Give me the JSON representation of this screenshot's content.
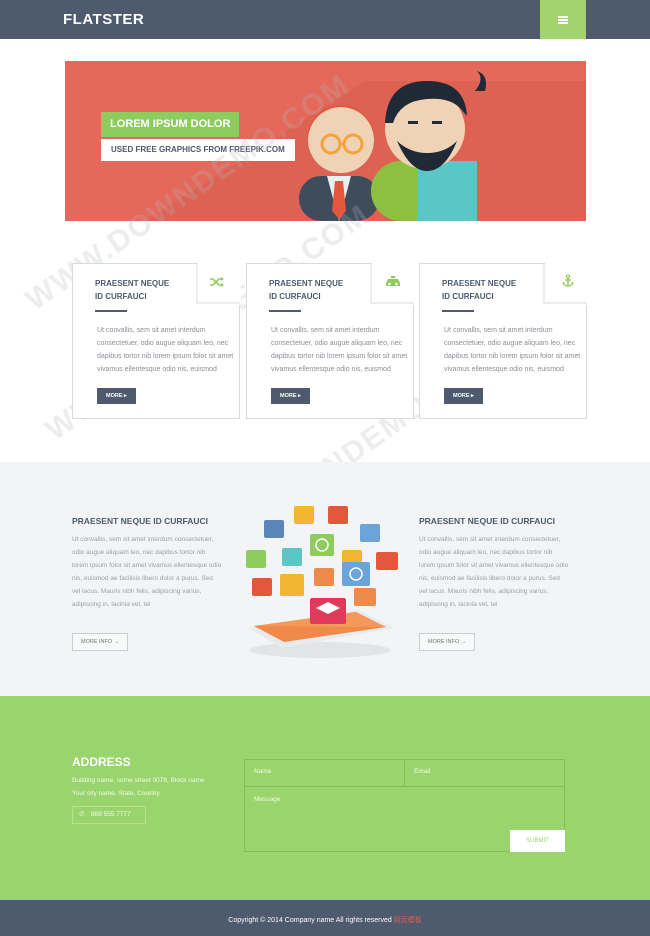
{
  "header": {
    "brand": "FLATSTER",
    "menu_icon": "hamburger-icon"
  },
  "hero": {
    "title": "LOREM IPSUM DOLOR",
    "subtitle": "USED FREE GRAPHICS FROM FREEPIK.COM"
  },
  "cards": [
    {
      "title_line1": "PRAESENT NEQUE",
      "title_line2": "ID CURFAUCI",
      "text": "Ut convallis, sem sit amet interdum consectetuer, odio augue aliquam leo, nec dapibus tortor nib lorem ipsum folor sit amet vivamus ellentesque odio nis, euismod",
      "button": "MORE",
      "icon": "shuffle-icon"
    },
    {
      "title_line1": "PRAESENT NEQUE",
      "title_line2": "ID CURFAUCI",
      "text": "Ut convallis, sem sit amet interdum consectetuer, odio augue aliquam leo, nec dapibus tortor nib lorem ipsum folor sit amet vivamus ellentesque odio nis, euismod",
      "button": "MORE",
      "icon": "taxi-icon"
    },
    {
      "title_line1": "PRAESENT NEQUE",
      "title_line2": "ID CURFAUCI",
      "text": "Ut convallis, sem sit amet interdum consectetuer, odio augue aliquam leo, nec dapibus tortor nib lorem ipsum folor sit amet vivamus ellentesque odio nis, euismod",
      "button": "MORE",
      "icon": "anchor-icon"
    }
  ],
  "info": {
    "left": {
      "title": "PRAESENT NEQUE ID CURFAUCI",
      "text": "Ut convallis, sem sit amet interdum consectetuer, odio augue aliquam leo, nec dapibus tortor nib lorem ipsum folor sit amet vivamus ellentesque odio nis, euismod ae facilisis libero dolor a purus. Sed vel lacus. Mauris nibh felis, adipiscing varius, adipiscing in, lacinia vel, tel",
      "button": "MORE INFO"
    },
    "right": {
      "title": "PRAESENT NEQUE ID CURFAUCI",
      "text": "Ut convallis, sem sit amet interdum consectetuer, odio augue aliquam leo, nec dapibus tortor nib lorem ipsum folor sit amet vivamus ellentesque odio nis, euismod ae facilisis libero dolor a purus. Sed vel lacus. Mauris nibh felis, adipiscing varius, adipiscing in, lacinia vel, tel",
      "button": "MORE INFO"
    }
  },
  "contact": {
    "title": "ADDRESS",
    "address": "Building name, some street 0078, Block name Your city name, State, Country",
    "phone": "888 555 7777",
    "name_placeholder": "Name",
    "email_placeholder": "Email",
    "message_placeholder": "Message",
    "submit": "SUBMIT"
  },
  "footer": {
    "copyright": "Copyright © 2014 Company name All rights reserved",
    "link": "网页模板"
  },
  "watermark": "WWW.DOWNDEMO.COM",
  "colors": {
    "dark": "#4e5a6e",
    "green": "#8dcd5e",
    "coral": "#e4695a"
  }
}
